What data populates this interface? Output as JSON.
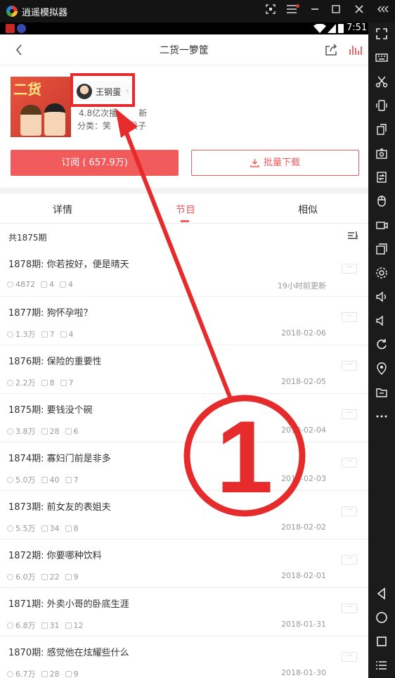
{
  "emulator": {
    "app_name": "逍遥模拟器",
    "time": "7:51"
  },
  "header": {
    "title": "二货一箩筐"
  },
  "album": {
    "author": "王钢蛋",
    "plays": "4.8亿次播",
    "plays_suffix": "新",
    "category": "分类：笑",
    "category_suffix": "段子",
    "subscribe_label": "订阅 ( 657.9万)",
    "download_label": "批量下载"
  },
  "tabs": [
    {
      "label": "详情"
    },
    {
      "label": "节目"
    },
    {
      "label": "相似"
    }
  ],
  "list": {
    "count": "共1875期"
  },
  "episodes": [
    {
      "title": "1878期: 你若按好，便是晴天",
      "plays": "4872",
      "likes": "4",
      "comments": "4",
      "date": "19小时前更新"
    },
    {
      "title": "1877期: 狗怀孕啦？",
      "plays": "1.3万",
      "likes": "7",
      "comments": "4",
      "date": "2018-02-06"
    },
    {
      "title": "1876期: 保险的重要性",
      "plays": "2.2万",
      "likes": "8",
      "comments": "7",
      "date": "2018-02-05"
    },
    {
      "title": "1875期: 要钱没个碗",
      "plays": "3.8万",
      "likes": "28",
      "comments": "6",
      "date": "2018-02-04"
    },
    {
      "title": "1874期: 寡妇门前是非多",
      "plays": "5.0万",
      "likes": "40",
      "comments": "7",
      "date": "2018-02-03"
    },
    {
      "title": "1873期: 前女友的表姐夫",
      "plays": "5.5万",
      "likes": "34",
      "comments": "8",
      "date": "2018-02-02"
    },
    {
      "title": "1872期: 你要哪种饮料",
      "plays": "6.0万",
      "likes": "22",
      "comments": "9",
      "date": "2018-02-01"
    },
    {
      "title": "1871期: 外卖小哥的卧底生涯",
      "plays": "6.8万",
      "likes": "31",
      "comments": "12",
      "date": "2018-01-31"
    },
    {
      "title": "1870期: 感觉他在炫耀些什么",
      "plays": "6.7万",
      "likes": "28",
      "comments": "9",
      "date": "2018-01-30"
    }
  ],
  "annotation": {
    "number": "1"
  },
  "colors": {
    "accent": "#f25b5b",
    "annotation": "#e52b2b"
  }
}
